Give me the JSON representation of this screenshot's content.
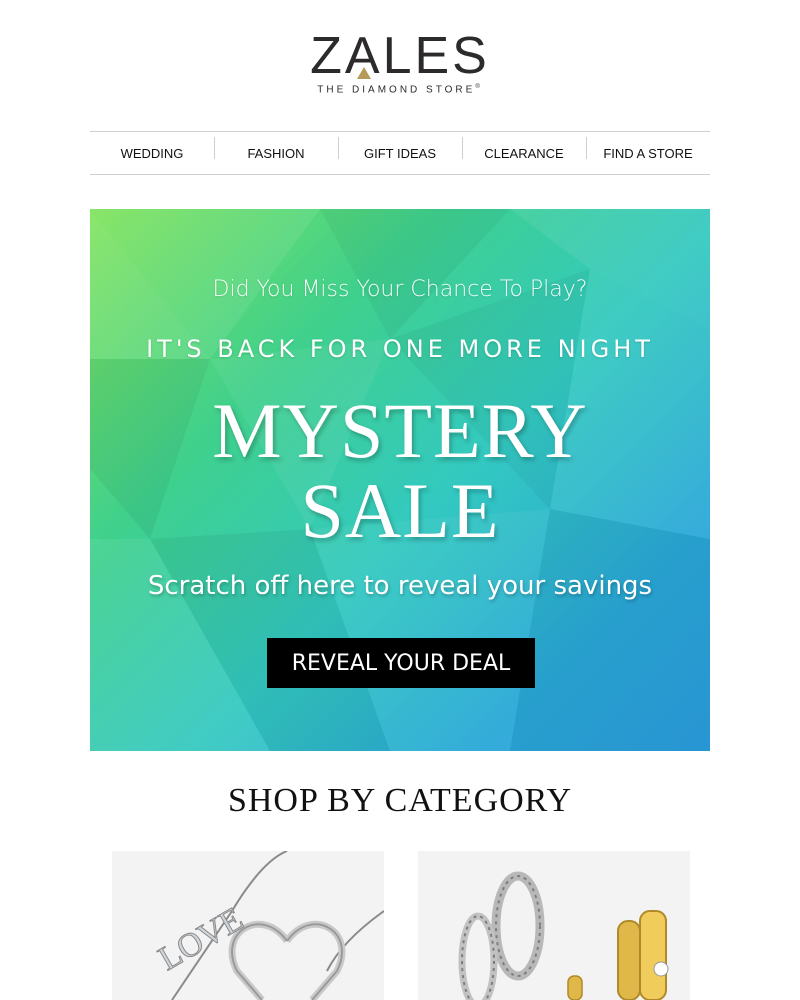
{
  "brand": {
    "name_pre": "Z",
    "name_a": "A",
    "name_post": "LES",
    "tagline": "THE DIAMOND STORE",
    "tm": "®"
  },
  "nav": {
    "items": [
      {
        "label": "WEDDING"
      },
      {
        "label": "FASHION"
      },
      {
        "label": "GIFT IDEAS"
      },
      {
        "label": "CLEARANCE"
      },
      {
        "label": "FIND A STORE"
      }
    ]
  },
  "hero": {
    "question": "Did You Miss Your Chance To Play?",
    "back": "IT'S BACK FOR ONE MORE NIGHT",
    "title_line1": "MYSTERY",
    "title_line2": "SALE",
    "scratch": "Scratch off here to reveal your savings",
    "button": "REVEAL YOUR DEAL"
  },
  "section": {
    "title": "SHOP BY CATEGORY"
  },
  "categories": [
    {
      "icon": "necklace-image"
    },
    {
      "icon": "earrings-image"
    }
  ],
  "colors": {
    "logo_gold": "#b59a5a",
    "button_bg": "#000000",
    "hero_green": "#7fe35a",
    "hero_blue": "#2b9ee0"
  }
}
